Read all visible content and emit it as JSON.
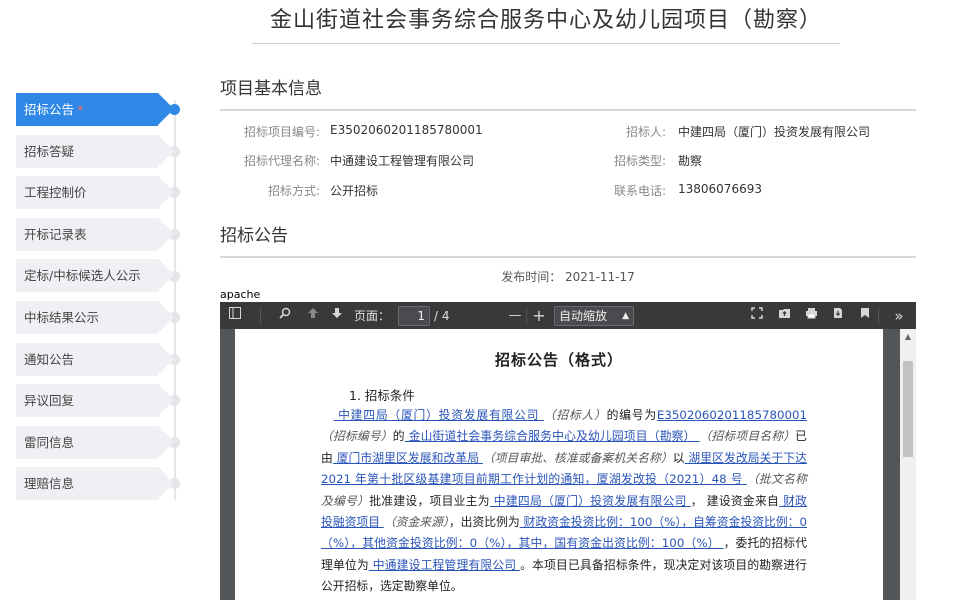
{
  "title": "金山街道社会事务综合服务中心及幼儿园项目（勘察）",
  "sidebar": {
    "items": [
      {
        "label": "招标公告",
        "required": "*"
      },
      {
        "label": "招标答疑"
      },
      {
        "label": "工程控制价"
      },
      {
        "label": "开标记录表"
      },
      {
        "label": "定标/中标候选人公示"
      },
      {
        "label": "中标结果公示"
      },
      {
        "label": "通知公告"
      },
      {
        "label": "异议回复"
      },
      {
        "label": "雷同信息"
      },
      {
        "label": "理赔信息"
      }
    ]
  },
  "basic_info": {
    "heading": "项目基本信息",
    "project_no_label": "招标项目编号:",
    "project_no": "E3502060201185780001",
    "tenderer_label": "招标人:",
    "tenderer": "中建四局（厦门）投资发展有限公司",
    "agent_label": "招标代理名称:",
    "agent": "中通建设工程管理有限公司",
    "type_label": "招标类型:",
    "type": "勘察",
    "method_label": "招标方式:",
    "method": "公开招标",
    "phone_label": "联系电话:",
    "phone": "13806076693"
  },
  "notice": {
    "heading": "招标公告",
    "publish_time": "发布时间： 2021-11-17"
  },
  "viewer": {
    "apache_label": "apache",
    "page_label": "页面：",
    "page_current": "1",
    "page_total": "/ 4",
    "zoom": "自动缩放",
    "icons": {
      "sidebar": "sidebar-toggle-icon",
      "search": "search-icon",
      "prev": "arrow-up-icon",
      "next": "arrow-down-icon",
      "zoom_out": "minus-icon",
      "zoom_in": "plus-icon",
      "fullscreen": "fullscreen-icon",
      "open": "folder-open-icon",
      "print": "print-icon",
      "download": "download-icon",
      "bookmark": "bookmark-icon",
      "more": "double-chevron-right-icon"
    }
  },
  "document": {
    "title": "招标公告（格式）",
    "section1": "1. 招标条件",
    "p_tenderer": " 中建四局（厦门）投资发展有限公司 ",
    "p_role_tenderer": "（招标人）",
    "p_no_pre": "的编号为",
    "p_no": "E3502060201185780001",
    "p_role_no": "（招标编号）",
    "p_de": "的",
    "p_project": " 金山街道社会事务综合服务中心及幼儿园项目（勘察） ",
    "p_role_project": "（招标项目名称）",
    "p_yiyou": "已由",
    "p_approver": " 厦门市湖里区发展和改革局 ",
    "p_role_approver": "（项目审批、核准或备案机关名称）",
    "p_yi": "以",
    "p_doc": " 湖里区发改局关于下达 2021 年第十批区级基建项目前期工作计划的通知，厦湖发改投（2021）48 号 ",
    "p_role_doc": "（批文名称及编号）",
    "p_approved": "批准建设，项目业主为",
    "p_owner": " 中建四局（厦门）投资发展有限公司 ",
    "p_fund_pre": "， 建设资金来自",
    "p_fund": " 财政投融资项目 ",
    "p_role_fund": "（资金来源）",
    "p_ratio_pre": "，出资比例为",
    "p_ratio": " 财政资金投资比例：100（%），自筹资金投资比例：0（%），其他资金投资比例：0（%），其中，国有资金出资比例：100（%） ",
    "p_agent_pre": "，委托的招标代理单位为",
    "p_agent": " 中通建设工程管理有限公司 ",
    "p_tail": "。本项目已具备招标条件，现决定对该项目的勘察进行公开招标，选定勘察单位。"
  }
}
